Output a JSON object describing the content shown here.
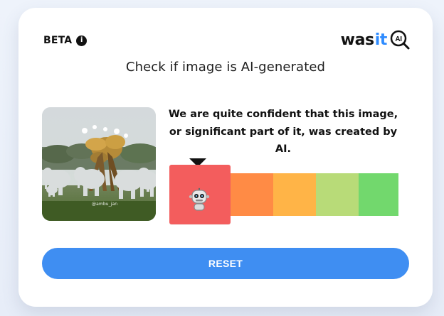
{
  "header": {
    "beta_label": "BETA",
    "info_icon": "info-icon",
    "brand_prefix": "was",
    "brand_highlight": "it",
    "brand_suffix": "AI",
    "brand_search_icon": "magnifier-ai-icon"
  },
  "main": {
    "headline": "Check if image is AI-generated",
    "analysis_text": "We are quite confident that this image, or significant part of it, was created by AI.",
    "thumbnail_credit": "@ambu_jan",
    "selected_icon": "robot-icon",
    "confidence_colors": [
      "#f35d5d",
      "#ff8b45",
      "#ffb447",
      "#b8db78",
      "#72d86d"
    ]
  },
  "actions": {
    "reset_label": "RESET"
  }
}
